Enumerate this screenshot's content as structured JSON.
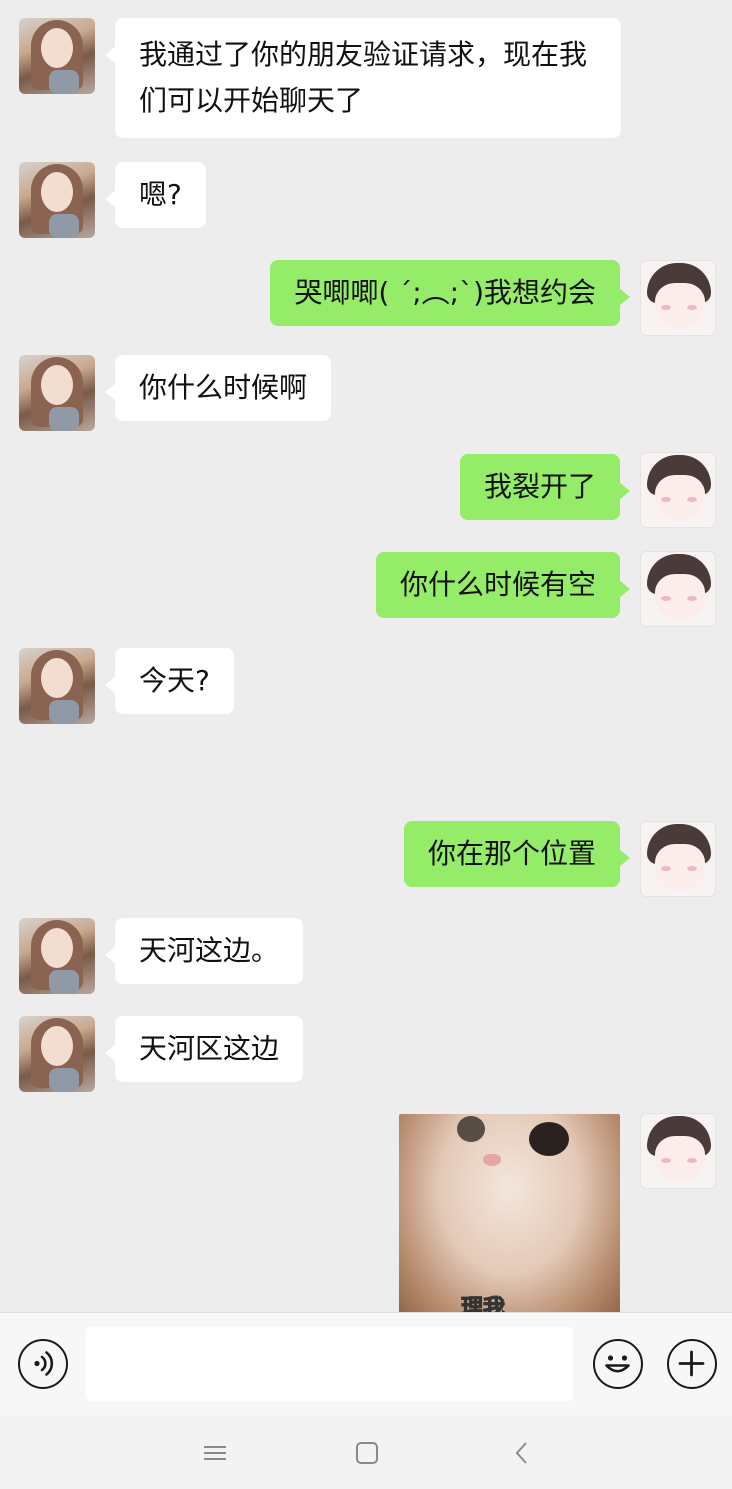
{
  "messages": [
    {
      "side": "in",
      "text": "我通过了你的朋友验证请求，现在我们可以开始聊天了"
    },
    {
      "side": "in",
      "text": "嗯?"
    },
    {
      "side": "out",
      "text": "哭唧唧( ´;︵;`)我想约会"
    },
    {
      "side": "in",
      "text": "你什么时候啊"
    },
    {
      "side": "out",
      "text": "我裂开了"
    },
    {
      "side": "out",
      "text": "你什么时候有空"
    },
    {
      "side": "in",
      "text": "今天?"
    },
    {
      "side": "out",
      "text": "你在那个位置"
    },
    {
      "side": "in",
      "text": "天河这边。"
    },
    {
      "side": "in",
      "text": "天河区这边"
    },
    {
      "side": "out",
      "type": "sticker",
      "caption": "理我"
    }
  ],
  "input": {
    "value": "",
    "placeholder": ""
  },
  "colors": {
    "background": "#ededed",
    "incoming_bubble": "#ffffff",
    "outgoing_bubble": "#95ec69"
  },
  "icons": {
    "voice": "voice-input-icon",
    "emoji": "emoji-icon",
    "plus": "plus-icon",
    "nav_menu": "menu-icon",
    "nav_home": "home-square-icon",
    "nav_back": "back-chevron-icon"
  }
}
